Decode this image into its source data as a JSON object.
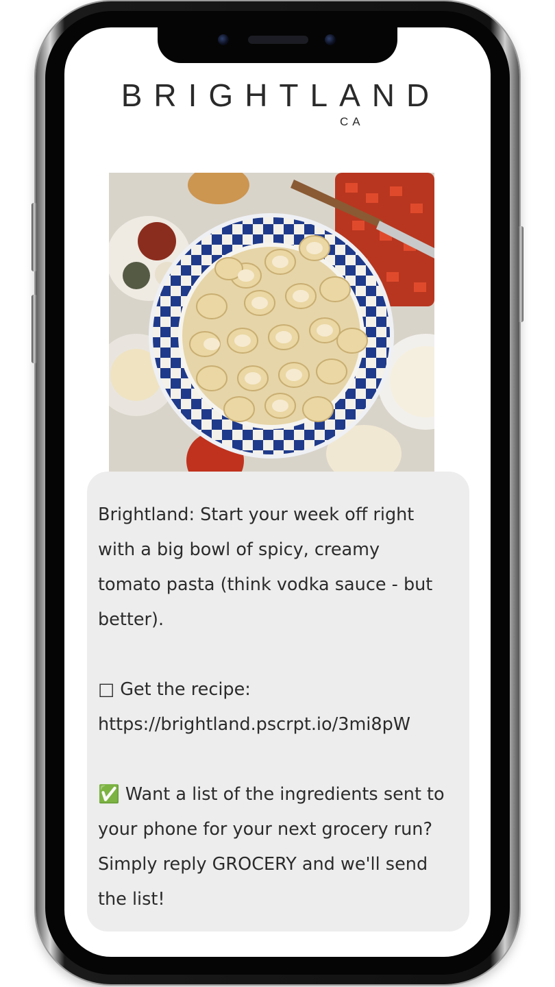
{
  "brand": {
    "name": "BRIGHTLAND",
    "sub": "CA"
  },
  "photo": {
    "alt": "Bowl of paccheri pasta with tomatoes and spices"
  },
  "message": {
    "text": "Brightland: Start your week off right with a big bowl of spicy, creamy tomato pasta (think vodka sauce - but better).\n\n□ Get the recipe: https://brightland.pscrpt.io/3mi8pW\n\n✅ Want a list of the ingredients sent to your phone for your next grocery run? Simply reply GROCERY and we'll send the list!",
    "lines": [
      "Brightland: Start your week off right",
      "with a big bowl of spicy, creamy",
      "tomato pasta (think vodka sauce - but",
      "better).",
      "",
      "□ Get the recipe:",
      "https://brightland.pscrpt.io/3mi8pW",
      "",
      "✅ Want a list of the ingredients sent to",
      "your phone for your next grocery run?",
      "Simply reply GROCERY and we'll send",
      "the list!"
    ]
  },
  "colors": {
    "bubble": "#ededed",
    "text": "#2b2b2b",
    "bowl_blue": "#1f3a8a"
  }
}
